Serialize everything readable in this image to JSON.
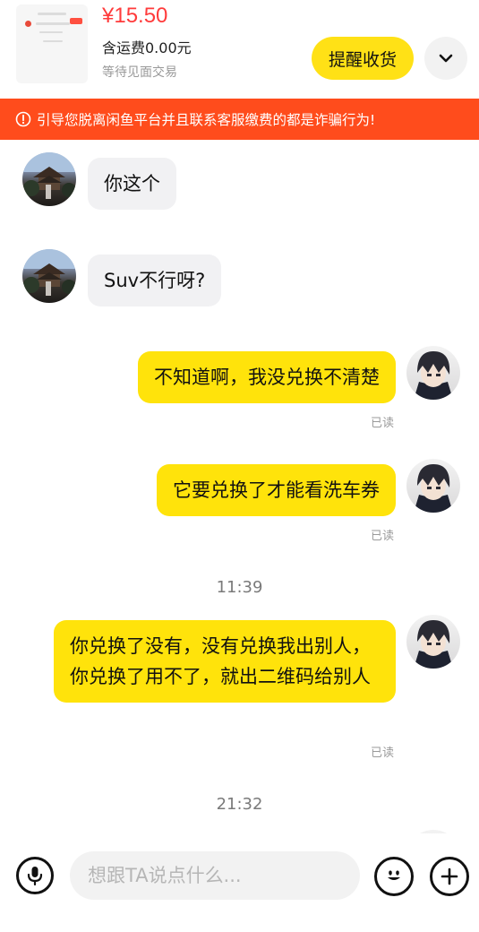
{
  "order": {
    "price": "¥15.50",
    "shipping": "含运费0.00元",
    "status": "等待见面交易",
    "remind_button": "提醒收货",
    "collapse_icon": "chevron-down-icon"
  },
  "warning": {
    "text": "引导您脱离闲鱼平台并且联系客服缴费的都是诈骗行为!",
    "icon": "alert-circle-icon",
    "color": "#ff4c1c"
  },
  "messages": [
    {
      "side": "other",
      "text": "你这个"
    },
    {
      "side": "other",
      "text": "Suv不行呀?"
    },
    {
      "side": "self",
      "text": "不知道啊，我没兑换不清楚",
      "read": "已读"
    },
    {
      "side": "self",
      "text": "它要兑换了才能看洗车券",
      "read": "已读"
    },
    {
      "side": "self",
      "text": "你兑换了没有，没有兑换我出别人，你兑换了用不了，就出二维码给别人",
      "read": "已读"
    }
  ],
  "time_dividers": [
    "11:39",
    "21:32"
  ],
  "input": {
    "placeholder": "想跟TA说点什么...",
    "voice_icon": "microphone-icon",
    "emoji_icon": "emoji-icon",
    "plus_icon": "plus-icon"
  },
  "colors": {
    "accent_yellow": "#ffe30b",
    "price_red": "#ff3b3b",
    "other_bubble": "#f1f1f3"
  }
}
